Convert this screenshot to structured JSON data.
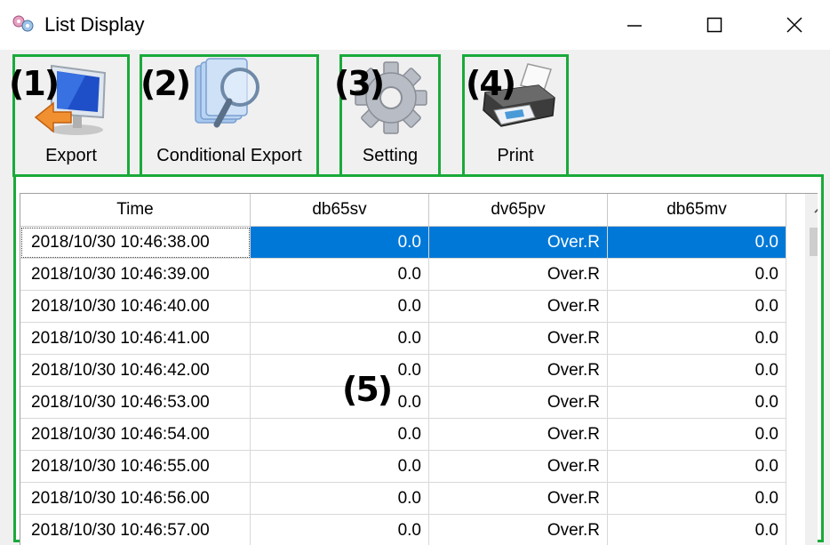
{
  "window": {
    "title": "List Display",
    "icon": "gears-app-icon",
    "controls": [
      "minimize",
      "maximize",
      "close"
    ]
  },
  "toolbar": {
    "buttons": [
      {
        "annotation": "(1)",
        "label": "Export",
        "icon": "monitor-export-arrow-icon"
      },
      {
        "annotation": "(2)",
        "label": "Conditional Export",
        "icon": "magnifier-documents-icon"
      },
      {
        "annotation": "(3)",
        "label": "Setting",
        "icon": "gear-icon"
      },
      {
        "annotation": "(4)",
        "label": "Print",
        "icon": "printer-icon"
      }
    ]
  },
  "grid": {
    "annotation": "(5)",
    "columns": [
      "Time",
      "db65sv",
      "dv65pv",
      "db65mv"
    ],
    "rows": [
      [
        "2018/10/30 10:46:38.00",
        "0.0",
        "Over.R",
        "0.0"
      ],
      [
        "2018/10/30 10:46:39.00",
        "0.0",
        "Over.R",
        "0.0"
      ],
      [
        "2018/10/30 10:46:40.00",
        "0.0",
        "Over.R",
        "0.0"
      ],
      [
        "2018/10/30 10:46:41.00",
        "0.0",
        "Over.R",
        "0.0"
      ],
      [
        "2018/10/30 10:46:42.00",
        "0.0",
        "Over.R",
        "0.0"
      ],
      [
        "2018/10/30 10:46:53.00",
        "0.0",
        "Over.R",
        "0.0"
      ],
      [
        "2018/10/30 10:46:54.00",
        "0.0",
        "Over.R",
        "0.0"
      ],
      [
        "2018/10/30 10:46:55.00",
        "0.0",
        "Over.R",
        "0.0"
      ],
      [
        "2018/10/30 10:46:56.00",
        "0.0",
        "Over.R",
        "0.0"
      ],
      [
        "2018/10/30 10:46:57.00",
        "0.0",
        "Over.R",
        "0.0"
      ]
    ],
    "selected_row": 0
  },
  "colors": {
    "annotation_box": "#1aaa3a",
    "selection": "#0078d7"
  }
}
